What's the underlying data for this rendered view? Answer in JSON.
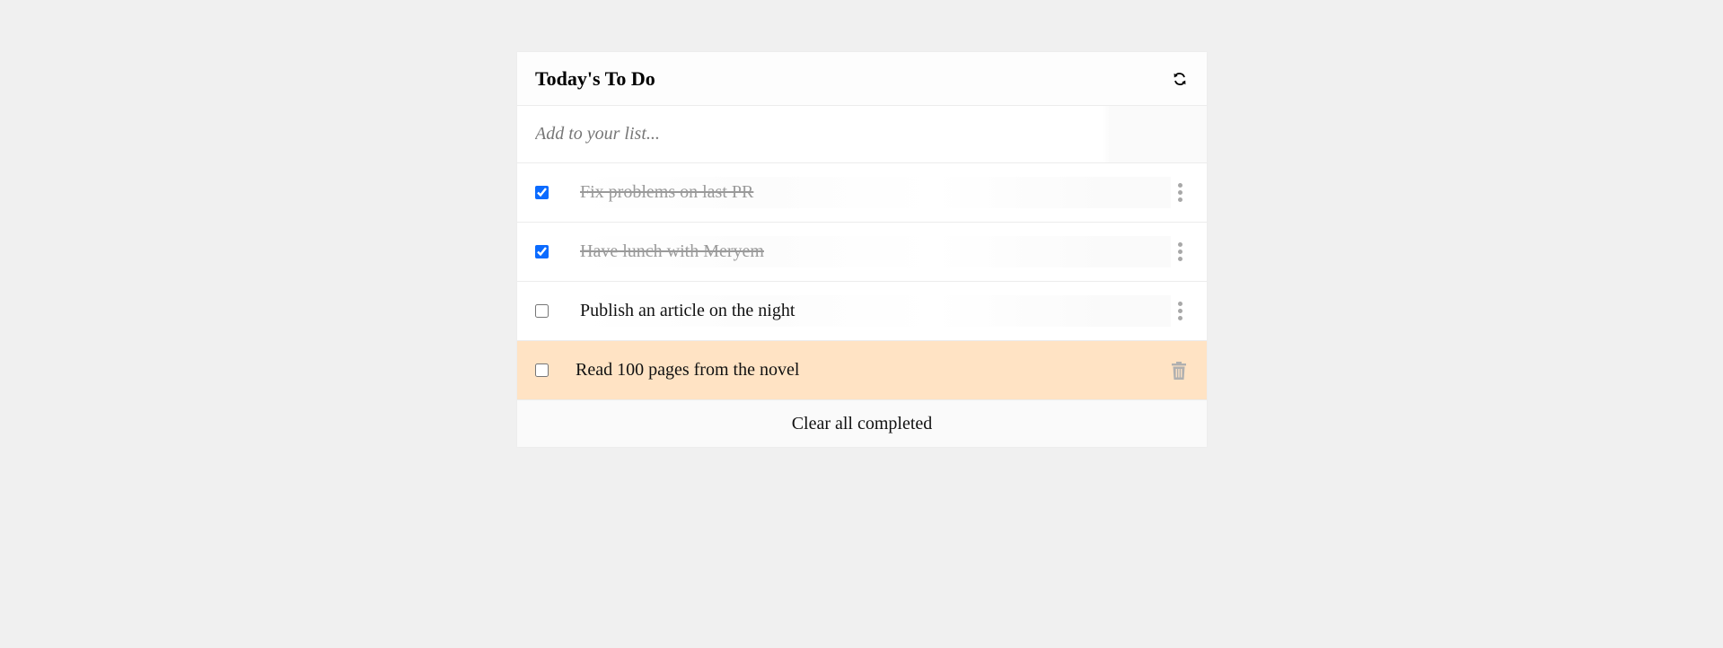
{
  "header": {
    "title": "Today's To Do",
    "refresh_icon": "refresh-icon"
  },
  "add": {
    "placeholder": "Add to your list..."
  },
  "items": [
    {
      "text": "Fix problems on last PR",
      "completed": true
    },
    {
      "text": "Have lunch with Meryem ",
      "completed": true
    },
    {
      "text": "Publish an article on the night",
      "completed": false
    },
    {
      "text": "Read 100 pages from the novel",
      "completed": false,
      "hovered": true
    }
  ],
  "footer": {
    "clear_label": "Clear all completed"
  },
  "colors": {
    "background": "#f0f0f0",
    "hover_row": "#ffe3c4",
    "checkbox_accent": "#0b6bff",
    "completed_text": "#9a9a9a"
  }
}
